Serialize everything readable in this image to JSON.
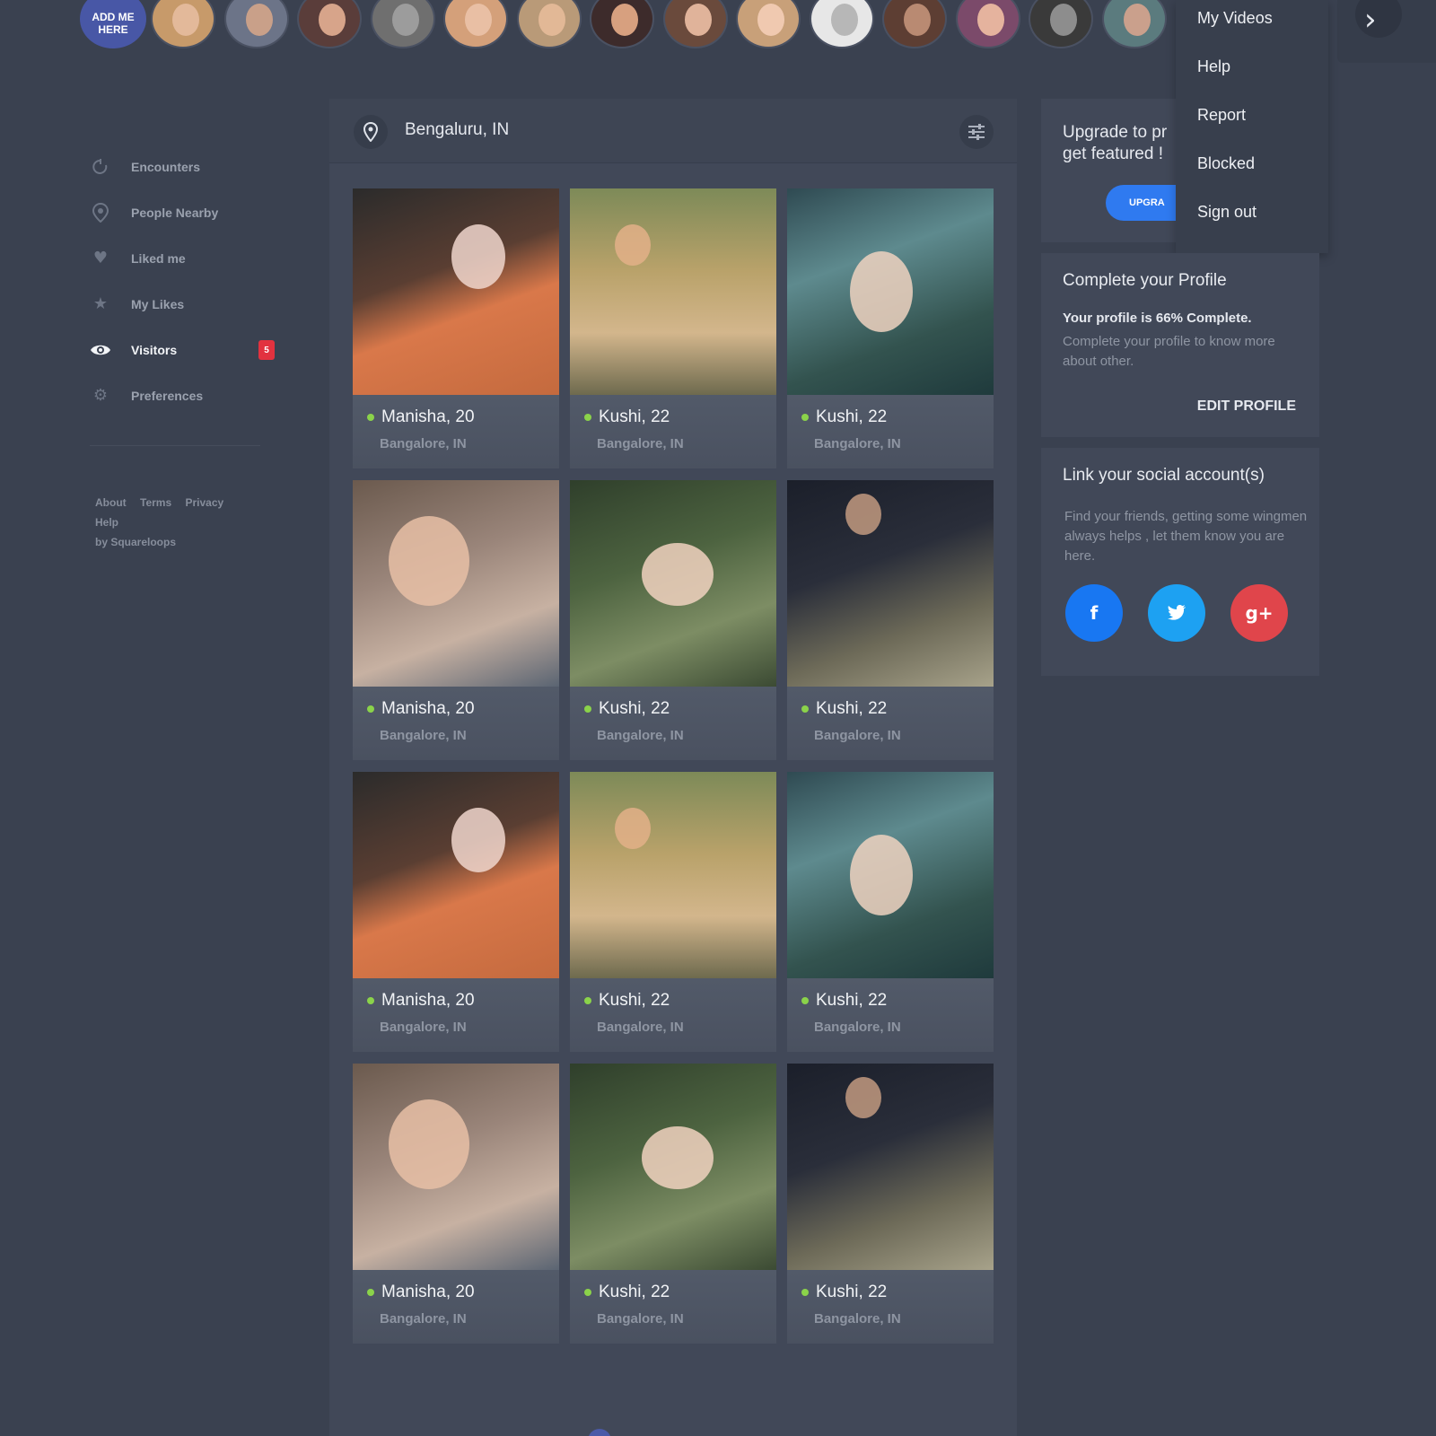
{
  "colors": {
    "background": "#3a4150",
    "panel": "#414858",
    "accent_blue": "#2f7af0",
    "online_green": "#8bd34a",
    "badge_red": "#e2323f",
    "facebook": "#1877f2",
    "twitter": "#1da1f2",
    "google_plus": "#e0454b"
  },
  "story_bar": {
    "add_me_label": "ADD ME HERE",
    "avatar_count": 14,
    "next_icon": "chevron-right-icon"
  },
  "sidebar": {
    "items": [
      {
        "label": "Encounters",
        "icon": "encounters-icon",
        "active": false
      },
      {
        "label": "People Nearby",
        "icon": "location-pin-icon",
        "active": false
      },
      {
        "label": "Liked me",
        "icon": "heart-icon",
        "active": false
      },
      {
        "label": "My Likes",
        "icon": "star-icon",
        "active": false
      },
      {
        "label": "Visitors",
        "icon": "eye-icon",
        "active": true,
        "badge": "5"
      },
      {
        "label": "Preferences",
        "icon": "gear-icon",
        "active": false
      }
    ],
    "footer": {
      "about": "About",
      "terms": "Terms",
      "privacy": "Privacy",
      "help": "Help",
      "credit": "by Squareloops"
    }
  },
  "main": {
    "location": "Bengaluru, IN",
    "filter_icon": "filter-sliders-icon",
    "cards": [
      {
        "name": "Manisha, 20",
        "location": "Bangalore, IN",
        "online": true
      },
      {
        "name": "Kushi, 22",
        "location": "Bangalore, IN",
        "online": true
      },
      {
        "name": "Kushi, 22",
        "location": "Bangalore, IN",
        "online": true
      },
      {
        "name": "Manisha, 20",
        "location": "Bangalore, IN",
        "online": true
      },
      {
        "name": "Kushi, 22",
        "location": "Bangalore, IN",
        "online": true
      },
      {
        "name": "Kushi, 22",
        "location": "Bangalore, IN",
        "online": true
      },
      {
        "name": "Manisha, 20",
        "location": "Bangalore, IN",
        "online": true
      },
      {
        "name": "Kushi, 22",
        "location": "Bangalore, IN",
        "online": true
      },
      {
        "name": "Kushi, 22",
        "location": "Bangalore, IN",
        "online": true
      },
      {
        "name": "Manisha, 20",
        "location": "Bangalore, IN",
        "online": true
      },
      {
        "name": "Kushi, 22",
        "location": "Bangalore, IN",
        "online": true
      },
      {
        "name": "Kushi, 22",
        "location": "Bangalore, IN",
        "online": true
      }
    ]
  },
  "dropdown_menu": {
    "items": [
      "My Videos",
      "Help",
      "Report",
      "Blocked",
      "Sign out"
    ]
  },
  "upgrade": {
    "text": "Upgrade to pr\nget featured !",
    "button_label": "UPGRA"
  },
  "profile": {
    "title": "Complete your Profile",
    "status": "Your profile is 66% Complete.",
    "description": "Complete your profile to know more about other.",
    "edit_label": "EDIT PROFILE"
  },
  "social": {
    "title": "Link your social account(s)",
    "description": "Find your friends, getting some wingmen always helps , let them know you are here.",
    "facebook_glyph": "f",
    "google_glyph": "g+"
  }
}
